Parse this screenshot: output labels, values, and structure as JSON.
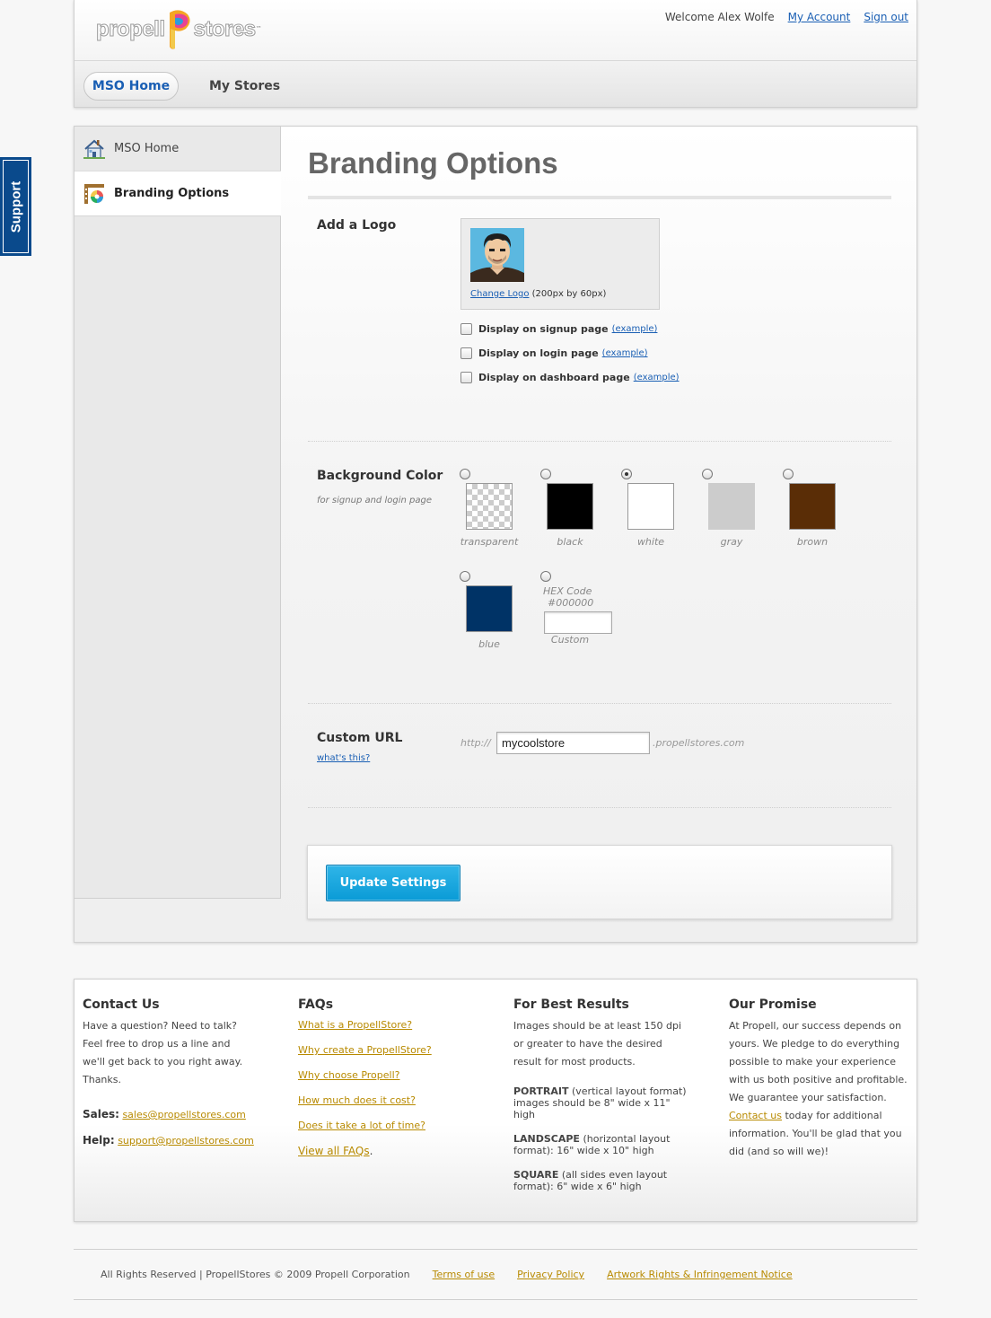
{
  "support_tab": {
    "label": "Support"
  },
  "header": {
    "logo": {
      "word_left": "propell",
      "word_right": "stores",
      "tm": "™"
    },
    "welcome": "Welcome Alex Wolfe",
    "my_account": "My Account",
    "sign_out": "Sign out",
    "tabs": [
      {
        "label": "MSO Home",
        "active": true
      },
      {
        "label": "My Stores",
        "active": false
      }
    ]
  },
  "sidebar": {
    "items": [
      {
        "label": "MSO Home",
        "icon": "house-icon"
      },
      {
        "label": "Branding Options",
        "icon": "palette-icon",
        "active": true
      }
    ]
  },
  "main": {
    "title": "Branding Options",
    "logo_section": {
      "label": "Add a Logo",
      "change_link": "Change Logo",
      "size_hint": "(200px by 60px)",
      "options": [
        {
          "label": "Display on signup page",
          "example": "(example)",
          "checked": false
        },
        {
          "label": "Display on login page",
          "example": "(example)",
          "checked": false
        },
        {
          "label": "Display on dashboard page",
          "example": "(example)",
          "checked": false
        }
      ]
    },
    "background": {
      "label": "Background Color",
      "sub": "for signup and login page",
      "selected": "white",
      "swatches": [
        {
          "label": "transparent",
          "color": "transparent"
        },
        {
          "label": "black",
          "color": "#000000"
        },
        {
          "label": "white",
          "color": "#ffffff"
        },
        {
          "label": "gray",
          "color": "#cccccc"
        },
        {
          "label": "brown",
          "color": "#5a2d06"
        },
        {
          "label": "blue",
          "color": "#003366"
        }
      ],
      "hex_label": "HEX Code",
      "hex_value": "#000000",
      "custom_label": "Custom",
      "custom_value": ""
    },
    "custom_url": {
      "label": "Custom URL",
      "help": "what's this?",
      "prefix": "http://",
      "value": "mycoolstore",
      "suffix": ".propellstores.com"
    },
    "update_button": "Update Settings"
  },
  "footer": {
    "contact": {
      "title": "Contact Us",
      "lines": [
        "Have a question? Need to talk?",
        "Feel free to drop us a line and",
        "we'll get back to you right away.",
        "Thanks."
      ],
      "sales_label": "Sales:",
      "sales_email": "sales@propellstores.com",
      "help_label": "Help:",
      "help_email": "support@propellstores.com"
    },
    "faqs": {
      "title": "FAQs",
      "links": [
        "What is a PropellStore?",
        "Why create a PropellStore?",
        "Why choose Propell?",
        "How much does it cost?",
        "Does it take a lot of time?"
      ],
      "view_all": "View all FAQs",
      "view_all_suffix": "."
    },
    "best_results": {
      "title": "For Best Results",
      "intro": [
        "Images should be at least 150 dpi",
        "or greater to have the desired",
        "result for most products."
      ],
      "portrait_term": "PORTRAIT",
      "portrait_text": " (vertical layout format) images should be 8\" wide x 11\" high",
      "landscape_term": "LANDSCAPE",
      "landscape_text": " (horizontal layout format): 16\" wide x 10\" high",
      "square_term": "SQUARE",
      "square_text": " (all sides even layout format): 6\" wide x 6\" high"
    },
    "promise": {
      "title": "Our Promise",
      "text_before": "At Propell, our success depends on yours. We pledge to do everything possible to make your experience with us both positive and profitable. We guarantee your satisfaction. ",
      "link": "Contact us",
      "text_after": " today for additional information. You'll be glad that you did (and so will we)!"
    }
  },
  "bottom": {
    "copyright": "All Rights Reserved | PropellStores © 2009 Propell Corporation",
    "links": [
      "Terms of use",
      "Privacy Policy",
      "Artwork Rights & Infringement Notice"
    ]
  }
}
